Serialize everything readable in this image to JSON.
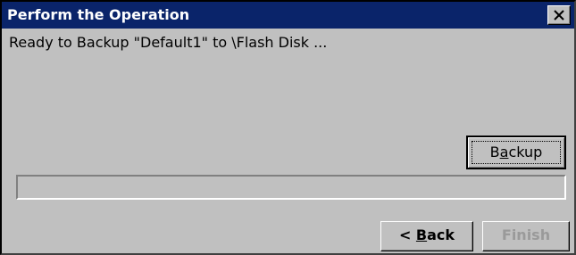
{
  "dialog": {
    "title": "Perform the Operation",
    "close_icon": "close-icon",
    "message": "Ready to Backup \"Default1\" to \\Flash Disk ...",
    "progress_fraction": 0
  },
  "buttons": {
    "backup": {
      "pre": "B",
      "accel": "a",
      "post": "ckup"
    },
    "back": {
      "pre": "< ",
      "accel": "B",
      "post": "ack"
    },
    "finish": {
      "label": "Finish",
      "enabled": false
    }
  },
  "colors": {
    "title_bar": "#0a246a",
    "face": "#c0c0c0",
    "disabled_text": "#9a9a9a"
  }
}
